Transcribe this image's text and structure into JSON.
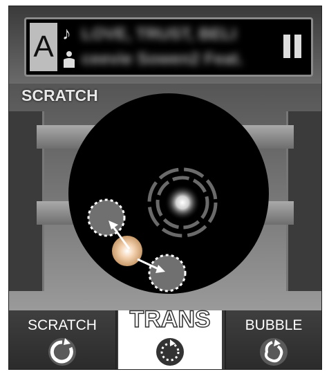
{
  "player": {
    "deck_letter": "A",
    "track_title": "LOVE, TRUST, BELI",
    "track_artist": "ceevie Sowen2 Feat.",
    "note_icon": "music-note-icon",
    "artist_icon": "artist-icon",
    "pause_icon": "pause-icon"
  },
  "main": {
    "mode_label": "SCRATCH"
  },
  "modes": {
    "scratch": {
      "label": "SCRATCH",
      "icon": "rotate-arrow-icon"
    },
    "trans": {
      "label": "TRANS",
      "icon": "dotted-circle-icon",
      "selected": true
    },
    "bubble": {
      "label": "BUBBLE",
      "icon": "bubble-arrow-icon"
    }
  },
  "colors": {
    "background": "#5a5a5a",
    "disc": "#000000",
    "touch_point": "#707070",
    "accent_glow": "#f2c8a0"
  }
}
